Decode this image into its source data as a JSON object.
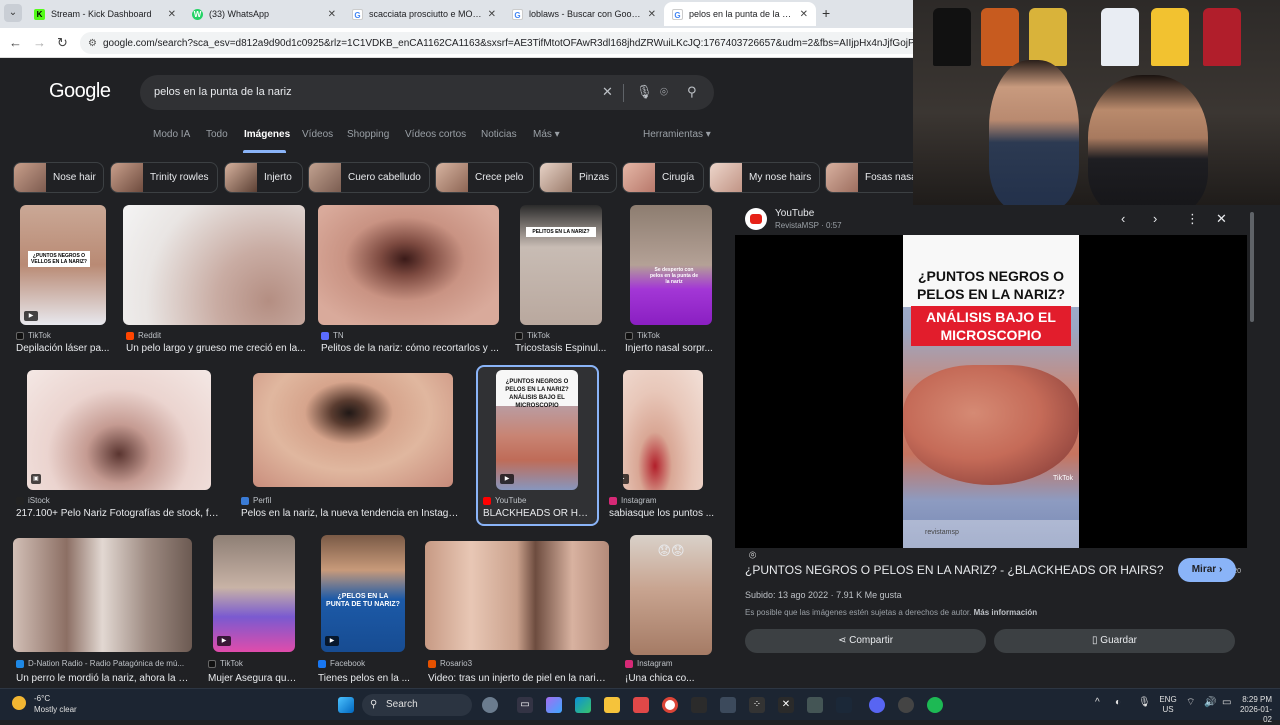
{
  "browser": {
    "tabs": [
      {
        "title": "Stream - Kick Dashboard",
        "color": "#53fc18",
        "glyph": "K"
      },
      {
        "title": "(33) WhatsApp",
        "color": "#25d366",
        "glyph": "W"
      },
      {
        "title": "scacciata prosciutto e MOZZAR...",
        "color": "#4285f4",
        "glyph": "G"
      },
      {
        "title": "loblaws - Buscar con Google",
        "color": "#4285f4",
        "glyph": "G"
      },
      {
        "title": "pelos en la punta de la nariz - B...",
        "color": "#4285f4",
        "glyph": "G"
      }
    ],
    "url": "google.com/search?sca_esv=d812a9d90d1c0925&rlz=1C1VDKB_enCA1162CA1163&sxsrf=AE3TifMtotOFAwR3dl168jhdZRWuiLKcJQ:1767403726657&udm=2&fbs=AIIjpHx4nJjfGojPVHhEACUHPiMQ"
  },
  "google": {
    "logo": "Google",
    "query": "pelos en la punta de la nariz",
    "tabs": [
      "Modo IA",
      "Todo",
      "Imágenes",
      "Vídeos",
      "Shopping",
      "Vídeos cortos",
      "Noticias",
      "Más ▾"
    ],
    "tools": "Herramientas ▾",
    "chips": [
      "Nose hair",
      "Trinity rowles",
      "Injerto",
      "Cuero cabelludo",
      "Crece pelo",
      "Pinzas",
      "Cirugía",
      "My nose hairs",
      "Fosas nasa"
    ]
  },
  "results": [
    {
      "source": "TikTok",
      "title": "Depilación láser pa...",
      "color": "#111111",
      "thumb_text": "¿PUNTOS NEGROS O VELLOS EN LA NARIZ?"
    },
    {
      "source": "Reddit",
      "title": "Un pelo largo y grueso me creció en la...",
      "color": "#ff4500",
      "thumb_text": ""
    },
    {
      "source": "TN",
      "title": "Pelitos de la nariz: cómo recortarlos y ...",
      "color": "#5b6cff",
      "thumb_text": ""
    },
    {
      "source": "TikTok",
      "title": "Tricostasis Espinul...",
      "color": "#111111",
      "thumb_text": "PELITOS EN LA NARIZ?"
    },
    {
      "source": "TikTok",
      "title": "Injerto nasal sorpr...",
      "color": "#111111",
      "thumb_text": "Se desperto con pelos en la punta de la nariz"
    },
    {
      "source": "iStock",
      "title": "217.100+ Pelo Nariz Fotografías de stock, fot...",
      "color": "#222222",
      "thumb_text": ""
    },
    {
      "source": "Perfil",
      "title": "Pelos en la nariz, la nueva tendencia en Instagra...",
      "color": "#3a7bd5",
      "thumb_text": ""
    },
    {
      "source": "YouTube",
      "title": "BLACKHEADS OR HA...",
      "color": "#ff0000",
      "thumb_text": "¿PUNTOS NEGROS O PELOS EN LA NARIZ? ANÁLISIS BAJO EL MICROSCOPIO"
    },
    {
      "source": "Instagram",
      "title": "sabiasque los puntos ...",
      "color": "#d62976",
      "thumb_text": ""
    },
    {
      "source": "D-Nation Radio - Radio Patagónica de mú...",
      "title": "Un perro le mordió la nariz, ahora la c...",
      "color": "#1e88e5",
      "thumb_text": ""
    },
    {
      "source": "TikTok",
      "title": "Mujer Asegura que...",
      "color": "#111111",
      "thumb_text": ""
    },
    {
      "source": "Facebook",
      "title": "Tienes pelos en la ...",
      "color": "#1877f2",
      "thumb_text": "¿PELOS EN LA PUNTA DE TU NARIZ?"
    },
    {
      "source": "Rosario3",
      "title": "Video: tras un injerto de piel en la nariz...",
      "color": "#e65100",
      "thumb_text": ""
    },
    {
      "source": "Instagram",
      "title": "¡Una chica co...",
      "color": "#d62976",
      "thumb_text": "😟😟"
    }
  ],
  "preview": {
    "site": "YouTube",
    "channel_line": "RevistaMSP · 0:57",
    "card_title": "¿PUNTOS NEGROS O PELOS EN LA NARIZ?",
    "card_banner": "ANÁLISIS BAJO EL MICROSCOPIO",
    "card_footer": "revistamsp",
    "watermark": "TikTok",
    "size": "405 × 720",
    "title": "¿PUNTOS NEGROS O PELOS EN LA NARIZ? - ¿BLACKHEADS OR HAIRS?",
    "visit_label": "Mirar ›",
    "meta": "Subido: 13 ago 2022 · 7.91 K Me gusta",
    "copyright": "Es posible que las imágenes estén sujetas a derechos de autor.",
    "more_info": "Más información",
    "share_label": "Compartir",
    "save_label": "Guardar"
  },
  "taskbar": {
    "temp": "-6°C",
    "condition": "Mostly clear",
    "search": "Search",
    "lang": "ENG",
    "region": "US",
    "time": "8:29 PM",
    "date": "2026-01-02"
  }
}
